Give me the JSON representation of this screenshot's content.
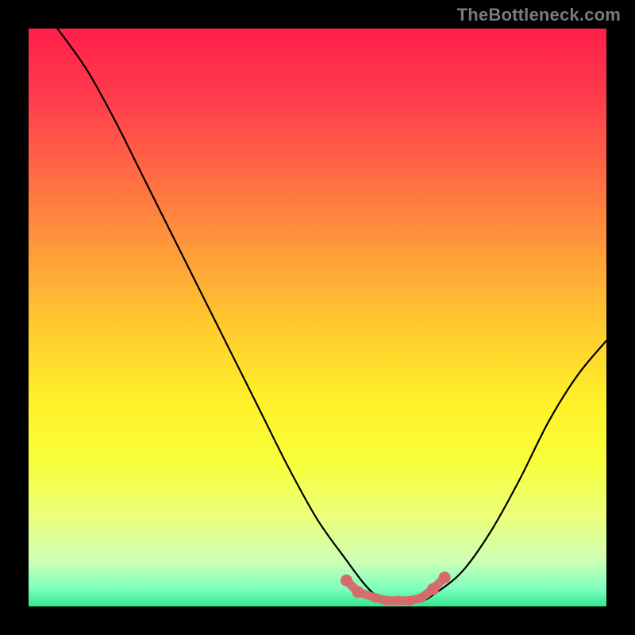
{
  "watermark": "TheBottleneck.com",
  "colors": {
    "background": "#000000",
    "watermark_text": "#7a7a7a",
    "curve_stroke": "#000000",
    "marker": "#d66a6a",
    "gradient_top": "#ff1f4a",
    "gradient_bottom": "#30e88e"
  },
  "chart_data": {
    "type": "line",
    "title": "",
    "xlabel": "",
    "ylabel": "",
    "xlim": [
      0,
      100
    ],
    "ylim": [
      0,
      100
    ],
    "grid": false,
    "legend": false,
    "series": [
      {
        "name": "bottleneck-curve",
        "x": [
          5,
          10,
          15,
          20,
          25,
          30,
          35,
          40,
          45,
          50,
          55,
          58,
          60,
          62,
          65,
          68,
          70,
          75,
          80,
          85,
          90,
          95,
          100
        ],
        "y": [
          100,
          93,
          84,
          74,
          64,
          54,
          44,
          34,
          24,
          15,
          8,
          4,
          2,
          1,
          1,
          1,
          2,
          6,
          13,
          22,
          32,
          40,
          46
        ]
      }
    ],
    "markers": {
      "name": "highlight-band",
      "x": [
        55,
        57,
        60,
        62,
        64,
        66,
        68,
        70,
        72
      ],
      "y": [
        4.5,
        2.5,
        1.5,
        1,
        1,
        1,
        1.5,
        3,
        5
      ]
    }
  }
}
